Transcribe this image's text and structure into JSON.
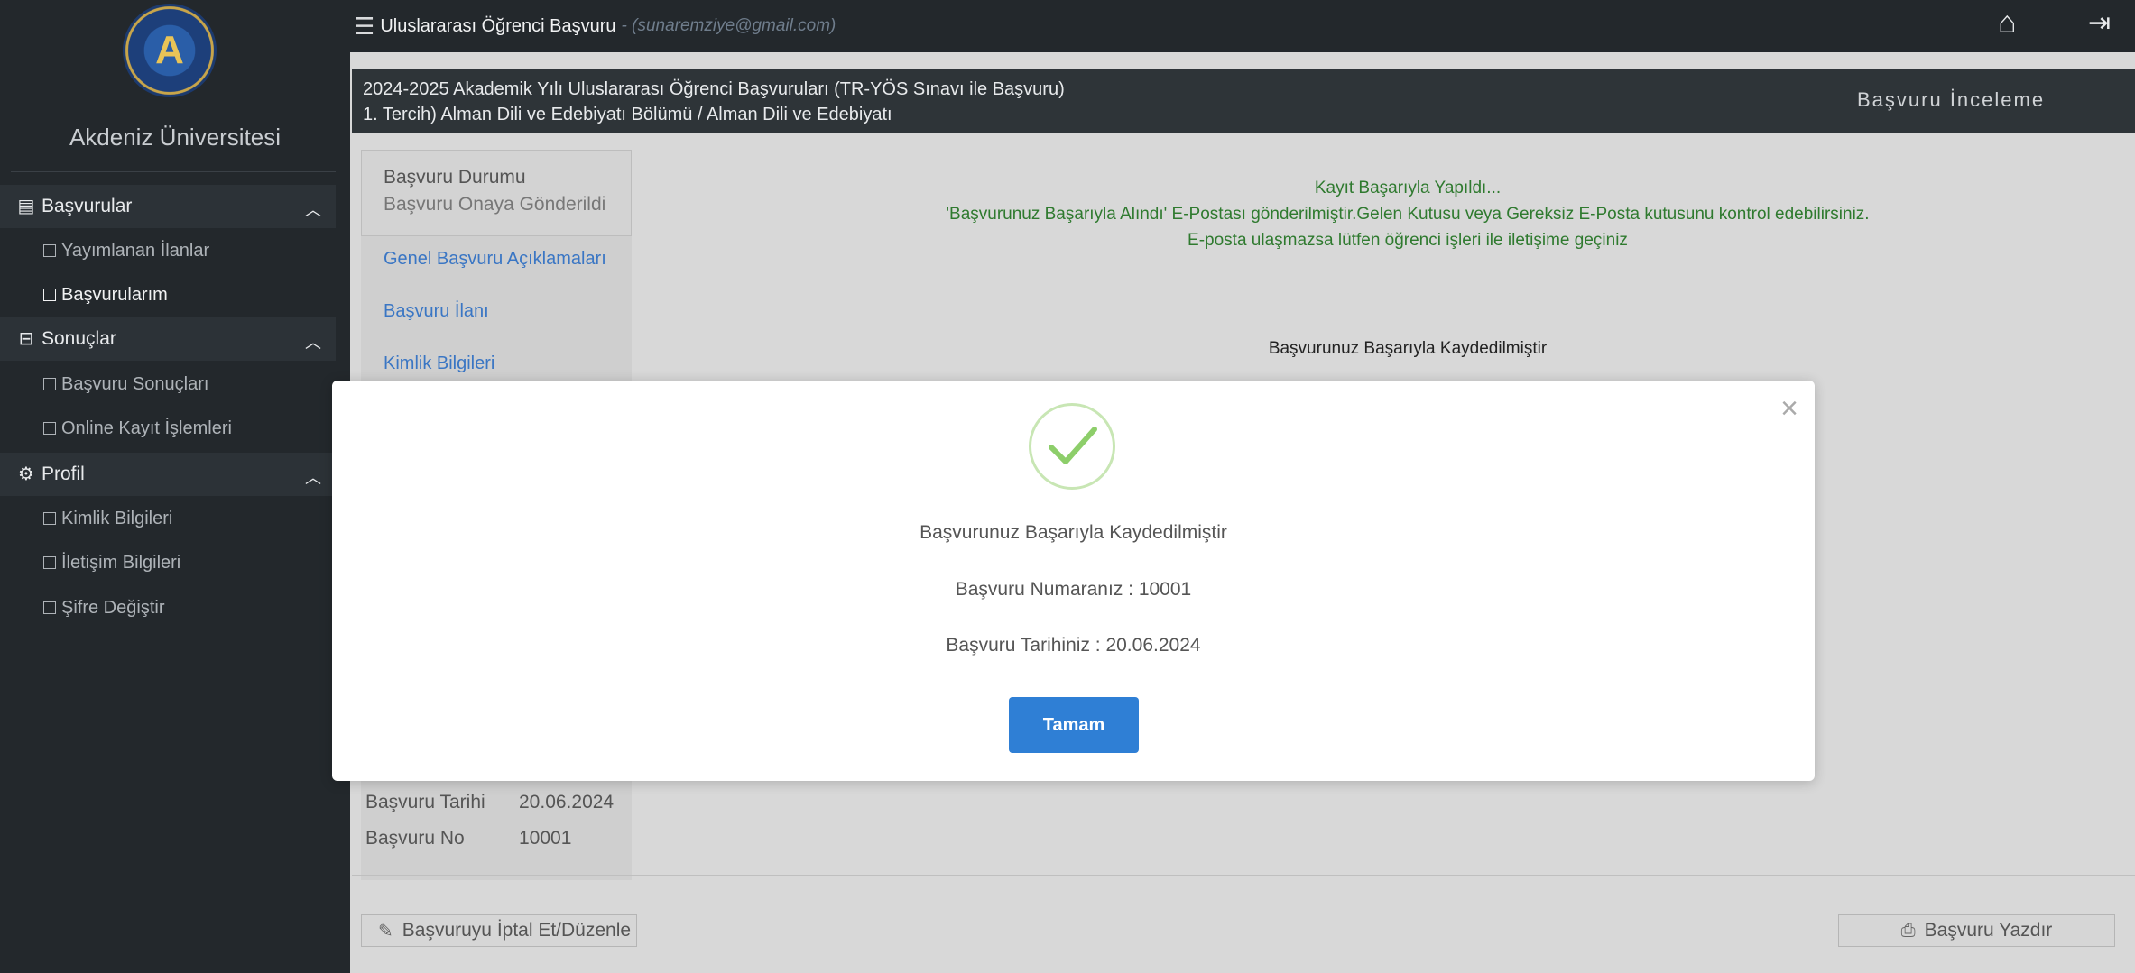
{
  "sidebar": {
    "university_name": "Akdeniz Üniversitesi",
    "sections": [
      {
        "label": "Başvurular",
        "items": [
          {
            "label": "Yayımlanan İlanlar"
          },
          {
            "label": "Başvurularım"
          }
        ]
      },
      {
        "label": "Sonuçlar",
        "items": [
          {
            "label": "Başvuru Sonuçları"
          },
          {
            "label": "Online Kayıt İşlemleri"
          }
        ]
      },
      {
        "label": "Profil",
        "items": [
          {
            "label": "Kimlik Bilgileri"
          },
          {
            "label": "İletişim Bilgileri"
          },
          {
            "label": "Şifre Değiştir"
          }
        ]
      }
    ]
  },
  "topbar": {
    "title": "Uluslararası Öğrenci Başvuru",
    "email": "- (sunaremziye@gmail.com)"
  },
  "header": {
    "line1": "2024-2025 Akademik Yılı Uluslararası Öğrenci Başvuruları (TR-YÖS Sınavı ile Başvuru)",
    "line2": "1. Tercih) Alman Dili ve Edebiyatı Bölümü / Alman Dili ve Edebiyatı",
    "right_label": "Başvuru İnceleme"
  },
  "left_panel": {
    "status_title": "Başvuru Durumu",
    "status_value": "Başvuru Onaya Gönderildi",
    "links": [
      "Genel Başvuru Açıklamaları",
      "Başvuru İlanı",
      "Kimlik Bilgileri"
    ]
  },
  "messages": {
    "line1": "Kayıt Başarıyla Yapıldı...",
    "line2": "'Başvurunuz Başarıyla Alındı' E-Postası gönderilmiştir.Gelen Kutusu veya Gereksiz E-Posta kutusunu kontrol edebilirsiniz.",
    "line3": "E-posta ulaşmazsa lütfen öğrenci işleri ile iletişime geçiniz",
    "saved": "Başvurunuz Başarıyla Kaydedilmiştir"
  },
  "details": {
    "date_label": "Başvuru Tarihi",
    "date_value": "20.06.2024",
    "no_label": "Başvuru No",
    "no_value": "10001"
  },
  "buttons": {
    "cancel_edit": "Başvuruyu İptal Et/Düzenle",
    "print": "Başvuru Yazdır"
  },
  "modal": {
    "message": "Başvurunuz Başarıyla Kaydedilmiştir",
    "number_text": "Başvuru Numaranız : 10001",
    "date_text": "Başvuru Tarihiniz : 20.06.2024",
    "ok_label": "Tamam",
    "close_glyph": "×"
  },
  "colors": {
    "sidebar_bg": "#23282c",
    "accent_blue": "#2f7fd5",
    "success_green": "#2f7a2f",
    "check_green": "#8dce6a"
  }
}
